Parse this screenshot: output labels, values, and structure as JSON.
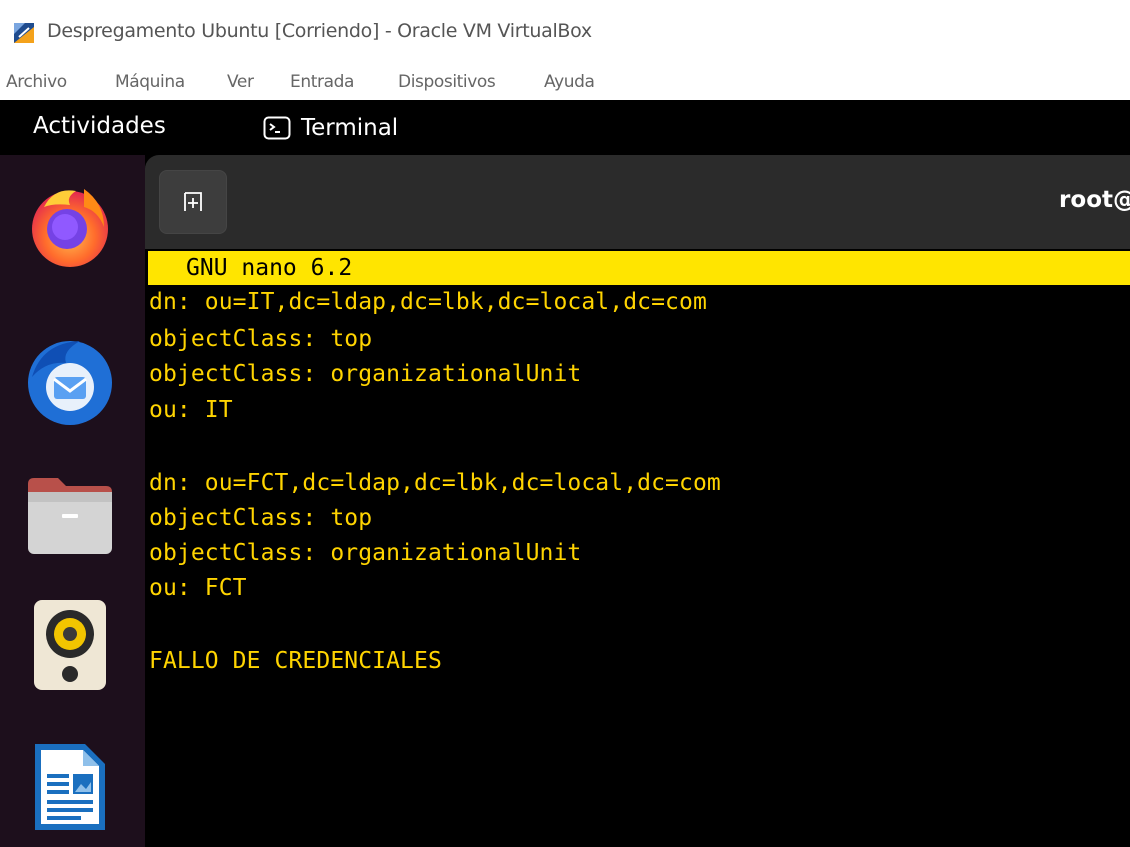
{
  "window": {
    "title": "Despregamento Ubuntu [Corriendo] - Oracle VM VirtualBox"
  },
  "menubar": {
    "items": [
      "Archivo",
      "Máquina",
      "Ver",
      "Entrada",
      "Dispositivos",
      "Ayuda"
    ]
  },
  "topbar": {
    "activities": "Actividades",
    "app_name": "Terminal"
  },
  "dock": {
    "items": [
      {
        "name": "Firefox",
        "icon": "firefox-icon"
      },
      {
        "name": "Thunderbird",
        "icon": "thunderbird-icon"
      },
      {
        "name": "Files",
        "icon": "files-icon"
      },
      {
        "name": "Rhythmbox",
        "icon": "rhythmbox-icon"
      },
      {
        "name": "LibreOffice Writer",
        "icon": "libreoffice-writer-icon"
      }
    ]
  },
  "terminal": {
    "title": "root@",
    "new_tab_icon": "new-tab-icon"
  },
  "nano": {
    "header": "GNU nano 6.2",
    "lines": [
      "dn: ou=IT,dc=ldap,dc=lbk,dc=local,dc=com",
      "objectClass: top",
      "objectClass: organizationalUnit",
      "ou: IT",
      "",
      "dn: ou=FCT,dc=ldap,dc=lbk,dc=local,dc=com",
      "objectClass: top",
      "objectClass: organizationalUnit",
      "ou: FCT",
      "",
      "FALLO DE CREDENCIALES"
    ]
  },
  "colors": {
    "nano_header_bg": "#ffe500",
    "nano_text": "#ffd400",
    "dock_bg": "#1d0f1c",
    "terminal_header_bg": "#2b2b2b"
  }
}
